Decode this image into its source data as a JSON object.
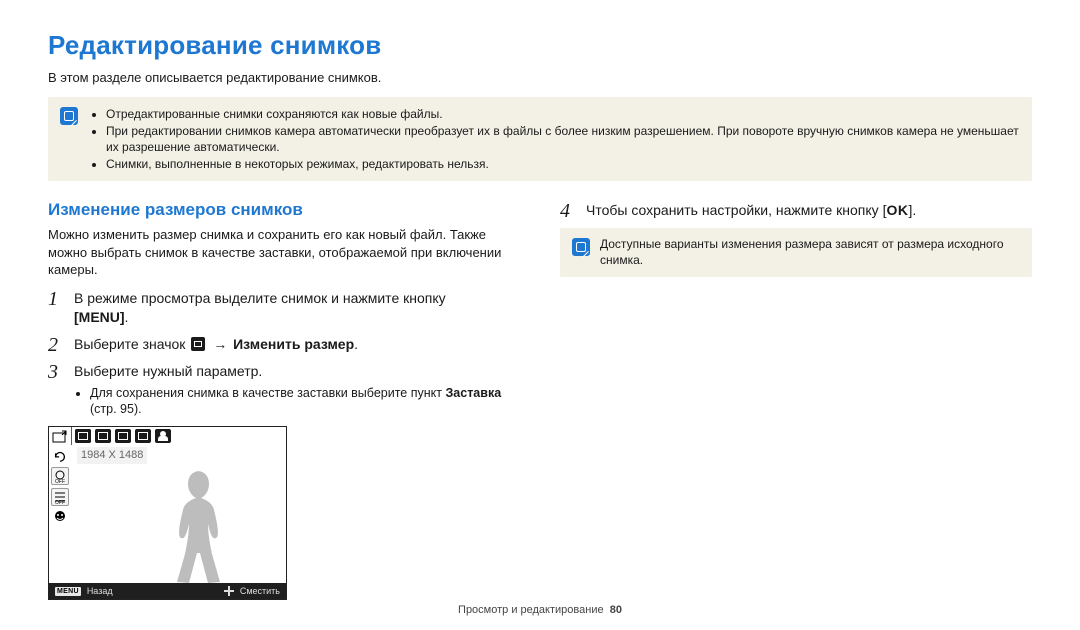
{
  "title": "Редактирование снимков",
  "subtitle": "В этом разделе описывается редактирование снимков.",
  "top_info": {
    "bullets": [
      "Отредактированные снимки сохраняются как новые файлы.",
      "При редактировании снимков камера автоматически преобразует их в файлы с более низким разрешением. При повороте вручную снимков камера не уменьшает их разрешение автоматически.",
      "Снимки, выполненные в некоторых режимах, редактировать нельзя."
    ]
  },
  "section_heading": "Изменение размеров снимков",
  "section_intro": "Можно изменить размер снимка и сохранить его как новый файл. Также можно выбрать снимок в качестве заставки, отображаемой при включении камеры.",
  "steps": {
    "s1": {
      "text": "В режиме просмотра выделите снимок и нажмите кнопку ",
      "button_label": "[MENU]"
    },
    "s2": {
      "prefix": "Выберите значок ",
      "arrow": "→",
      "action": "Изменить размер"
    },
    "s3": {
      "text": "Выберите нужный параметр.",
      "sub_prefix": "Для сохранения снимка в качестве заставки выберите пункт ",
      "sub_bold": "Заставка",
      "sub_suffix": " (стр. 95)."
    },
    "s4": {
      "prefix": "Чтобы сохранить настройки, нажмите кнопку ",
      "ok_open": "[",
      "ok_label": "OK",
      "ok_close": "]."
    }
  },
  "right_info": "Доступные варианты изменения размера зависят от размера исходного снимка.",
  "device": {
    "dim_label": "1984 X 1488",
    "menu_chip": "MENU",
    "back_label": "Назад",
    "move_label": "Сместить"
  },
  "footer": {
    "section": "Просмотр и редактирование",
    "page": "80"
  }
}
